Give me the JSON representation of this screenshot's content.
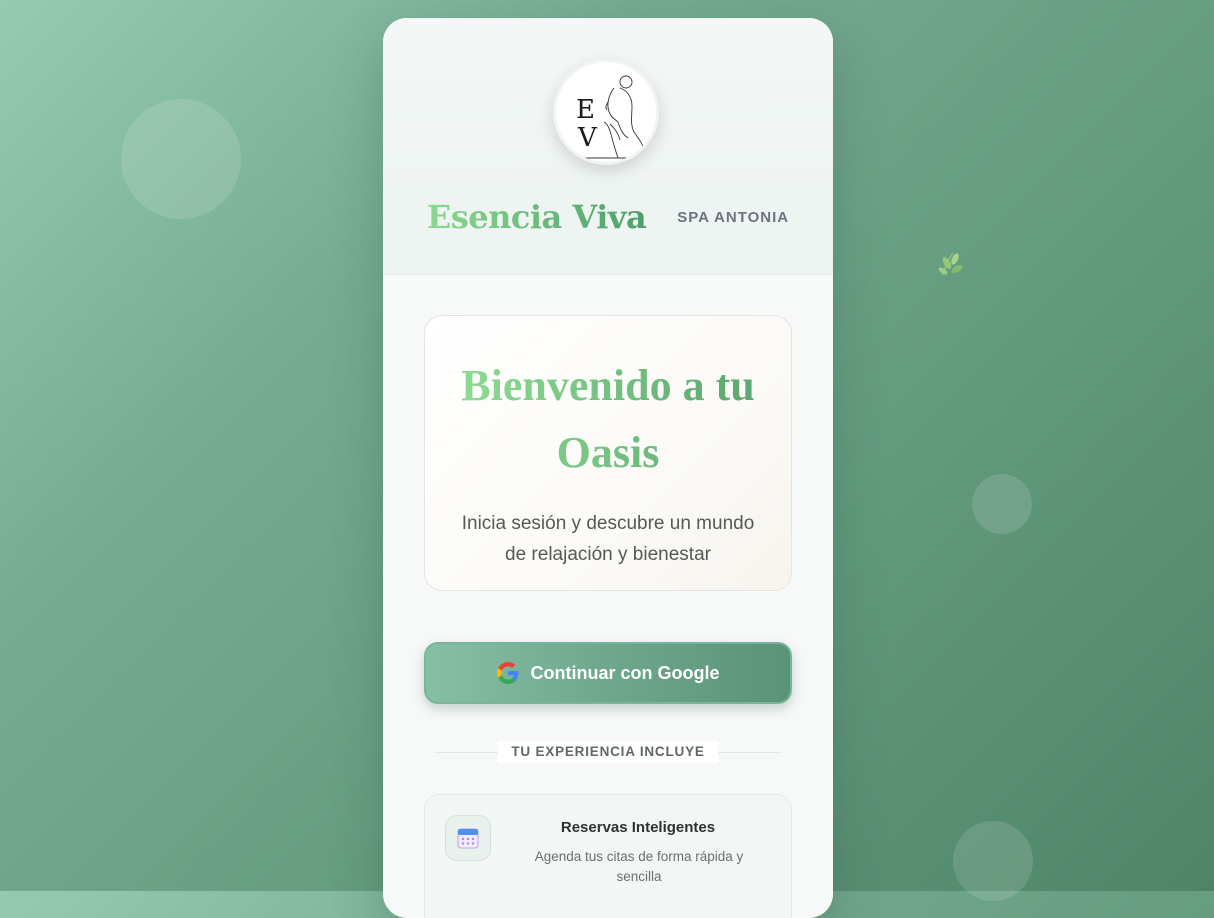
{
  "brand": {
    "logo_monogram_top": "E",
    "logo_monogram_bottom": "V",
    "name": "Esencia Viva",
    "subtitle": "SPA ANTONIA"
  },
  "welcome": {
    "title": "Bienvenido a tu Oasis",
    "text": "Inicia sesión y descubre un mundo de relajación y bienestar"
  },
  "login": {
    "google_label": "Continuar con Google"
  },
  "divider": {
    "label": "TU EXPERIENCIA INCLUYE"
  },
  "features": [
    {
      "title": "Reservas Inteligentes",
      "description": "Agenda tus citas de forma rápida y sencilla",
      "icon": "calendar-icon"
    }
  ],
  "colors": {
    "brand_green": "#5aa36f",
    "button_green": "#6fa78c",
    "background_green": "#629a7d"
  }
}
